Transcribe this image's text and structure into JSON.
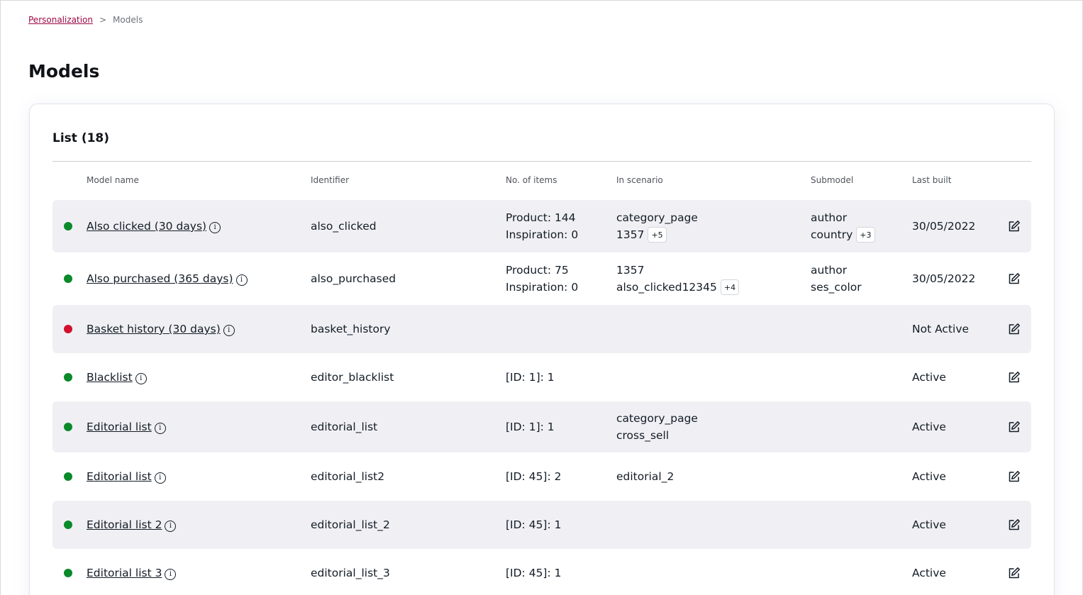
{
  "breadcrumb": {
    "parent": "Personalization",
    "separator": ">",
    "current": "Models"
  },
  "page_title": "Models",
  "list": {
    "title": "List (18)",
    "columns": {
      "name": "Model name",
      "identifier": "Identifier",
      "items": "No. of items",
      "scenario": "In scenario",
      "submodel": "Submodel",
      "last_built": "Last built"
    },
    "rows": [
      {
        "status": "green",
        "name": "Also clicked (30 days)",
        "identifier": "also_clicked",
        "items": [
          "Product: 144",
          "Inspiration: 0"
        ],
        "scenario": [
          "category_page",
          "1357"
        ],
        "scenario_more": "+5",
        "submodel": [
          "author",
          "country"
        ],
        "submodel_more": "+3",
        "last_built": "30/05/2022"
      },
      {
        "status": "green",
        "name": "Also purchased (365 days)",
        "identifier": "also_purchased",
        "items": [
          "Product: 75",
          "Inspiration: 0"
        ],
        "scenario": [
          "1357",
          "also_clicked12345"
        ],
        "scenario_more": "+4",
        "submodel": [
          "author",
          "ses_color"
        ],
        "last_built": "30/05/2022"
      },
      {
        "status": "red",
        "name": "Basket history (30 days)",
        "identifier": "basket_history",
        "last_built": "Not Active"
      },
      {
        "status": "green",
        "name": "Blacklist",
        "identifier": "editor_blacklist",
        "items": [
          "[ID: 1]: 1"
        ],
        "last_built": "Active"
      },
      {
        "status": "green",
        "name": "Editorial list",
        "identifier": "editorial_list",
        "items": [
          "[ID: 1]: 1"
        ],
        "scenario": [
          "category_page",
          "cross_sell"
        ],
        "last_built": "Active"
      },
      {
        "status": "green",
        "name": "Editorial list",
        "identifier": "editorial_list2",
        "items": [
          "[ID: 45]: 2"
        ],
        "scenario": [
          "editorial_2"
        ],
        "last_built": "Active"
      },
      {
        "status": "green",
        "name": "Editorial list 2",
        "identifier": "editorial_list_2",
        "items": [
          "[ID: 45]: 1"
        ],
        "last_built": "Active"
      },
      {
        "status": "green",
        "name": "Editorial list 3",
        "identifier": "editorial_list_3",
        "items": [
          "[ID: 45]: 1"
        ],
        "last_built": "Active"
      }
    ]
  },
  "icons": {
    "info": "info-icon",
    "edit": "edit-icon"
  },
  "colors": {
    "active": "#0a8a2a",
    "inactive": "#d3102f",
    "link": "#9b0a46",
    "row_shade": "#f0f0f4"
  }
}
